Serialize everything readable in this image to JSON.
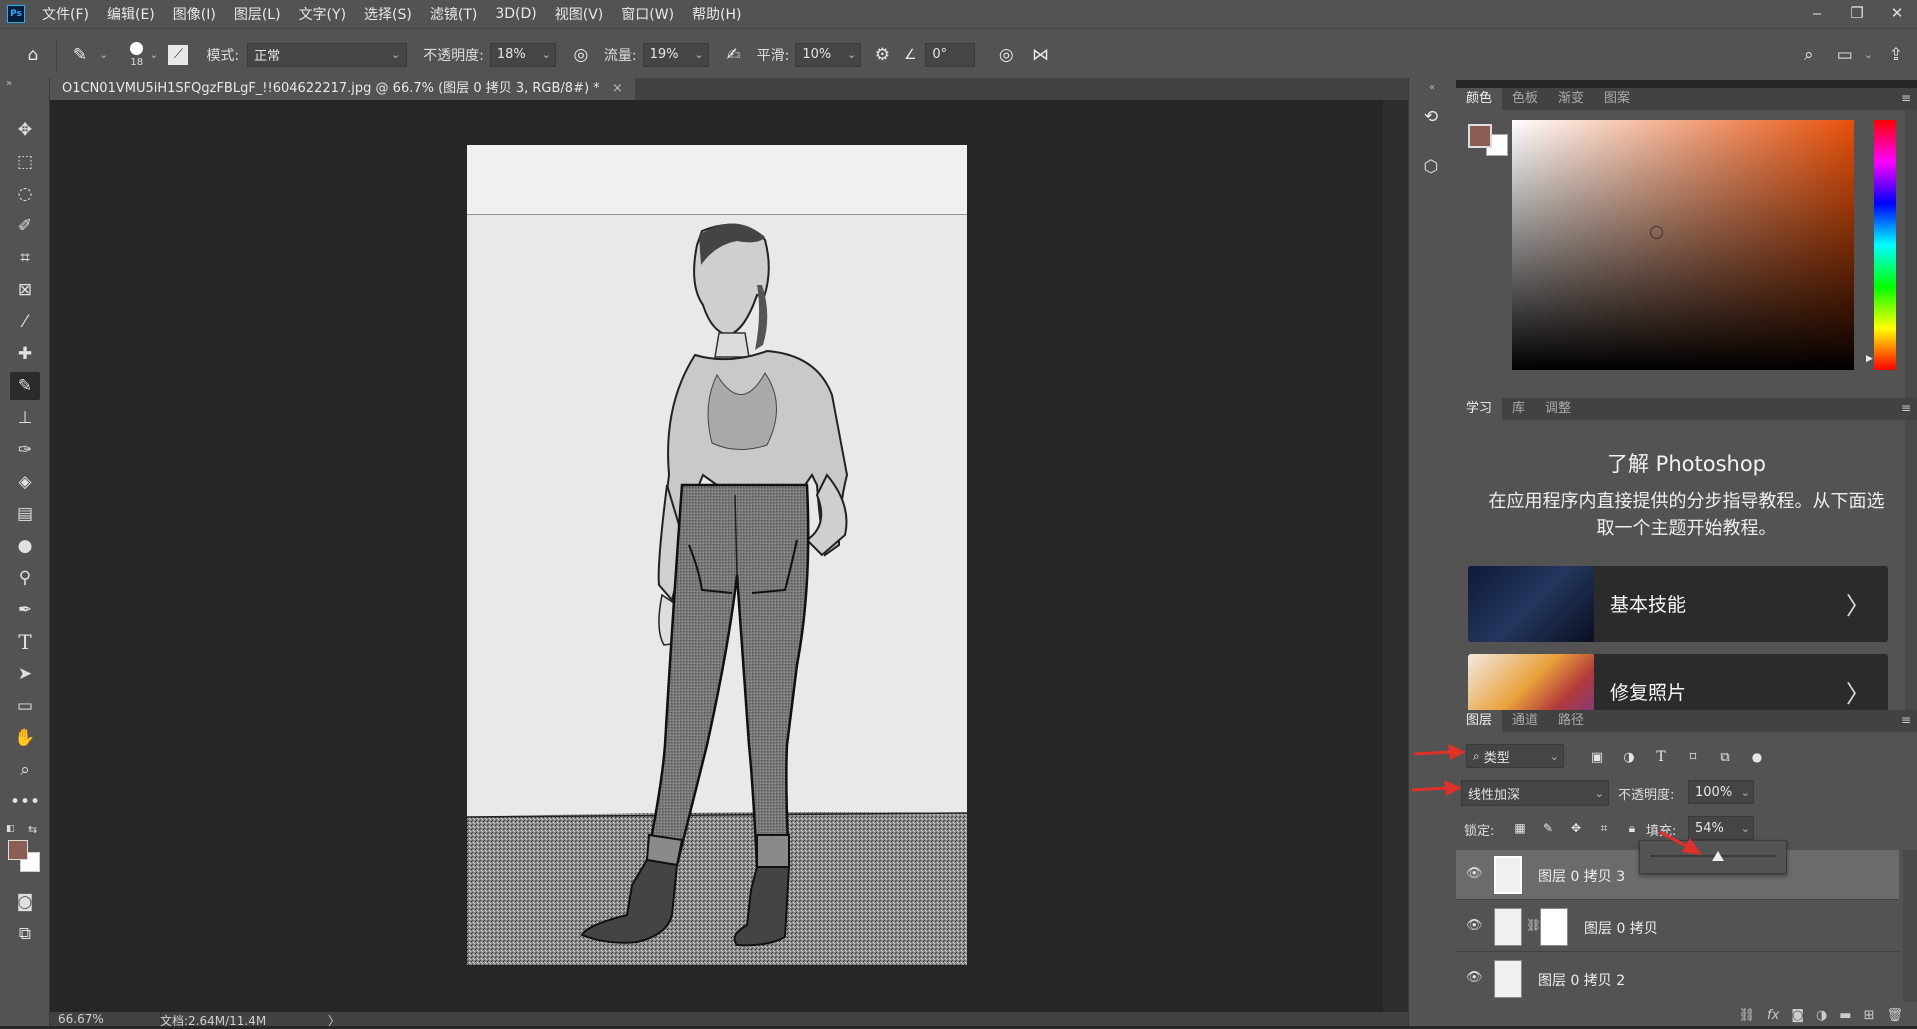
{
  "app": {
    "logo": "Ps"
  },
  "menu": [
    "文件(F)",
    "编辑(E)",
    "图像(I)",
    "图层(L)",
    "文字(Y)",
    "选择(S)",
    "滤镜(T)",
    "3D(D)",
    "视图(V)",
    "窗口(W)",
    "帮助(H)"
  ],
  "window_controls": {
    "minimize": "‒",
    "restore": "❐",
    "close": "✕"
  },
  "options_bar": {
    "brush_size": "18",
    "mode_label": "模式:",
    "mode_value": "正常",
    "opacity_label": "不透明度:",
    "opacity_value": "18%",
    "flow_label": "流量:",
    "flow_value": "19%",
    "smooth_label": "平滑:",
    "smooth_value": "10%",
    "angle_value": "0°"
  },
  "document": {
    "tab_title": "O1CN01VMU5iH1SFQgzFBLgF_!!604622217.jpg @ 66.7% (图层 0 拷贝 3, RGB/8#) *",
    "close": "×"
  },
  "status": {
    "zoom": "66.67%",
    "doc_info": "文档:2.64M/11.4M",
    "arrow": "〉"
  },
  "color_panel": {
    "tabs": [
      "颜色",
      "色板",
      "渐变",
      "图案"
    ],
    "foreground": "#8a5e52",
    "background": "#ffffff",
    "hue_color": "#e8500a"
  },
  "learn_panel": {
    "tabs": [
      "学习",
      "库",
      "调整"
    ],
    "title": "了解 Photoshop",
    "description": "在应用程序内直接提供的分步指导教程。从下面选取一个主题开始教程。",
    "tutorials": [
      {
        "label": "基本技能",
        "arrow": "〉"
      },
      {
        "label": "修复照片",
        "arrow": "〉"
      }
    ]
  },
  "layers_panel": {
    "tabs": [
      "图层",
      "通道",
      "路径"
    ],
    "filter_value": "类型",
    "blend_mode": "线性加深",
    "opacity_label": "不透明度:",
    "opacity_value": "100%",
    "lock_label": "锁定:",
    "fill_label": "填充:",
    "fill_value": "54%",
    "fill_slider_value": 0.54,
    "layers": [
      {
        "name": "图层 0 拷贝 3",
        "selected": true
      },
      {
        "name": "图层 0 拷贝",
        "selected": false
      },
      {
        "name": "图层 0 拷贝 2",
        "selected": false
      }
    ]
  }
}
